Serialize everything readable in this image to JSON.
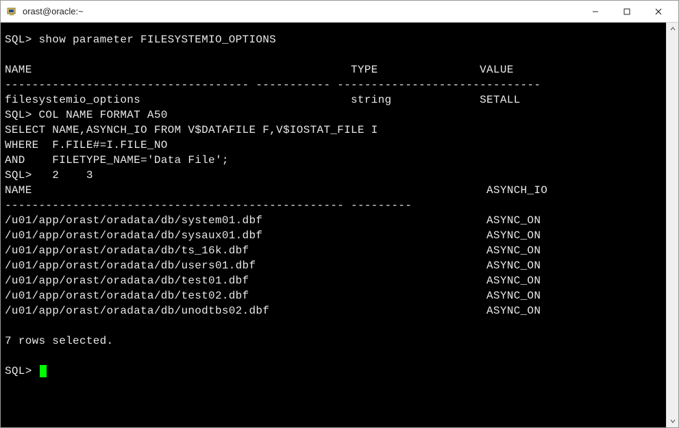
{
  "window": {
    "title": "orast@oracle:~"
  },
  "terminal": {
    "prompt": "SQL>",
    "lines": {
      "l0": "",
      "cmd1": "SQL> show parameter FILESYSTEMIO_OPTIONS",
      "blank1": "",
      "hdr1": "NAME                                               TYPE               VALUE",
      "sep1": "------------------------------------ ----------- ------------------------------",
      "row1": "filesystemio_options                               string             SETALL",
      "cmd2": "SQL> COL NAME FORMAT A50",
      "q1": "SELECT NAME,ASYNCH_IO FROM V$DATAFILE F,V$IOSTAT_FILE I",
      "q2": "WHERE  F.FILE#=I.FILE_NO",
      "q3": "AND    FILETYPE_NAME='Data File';",
      "q4": "SQL>   2    3",
      "hdr2": "NAME                                                                   ASYNCH_IO",
      "sep2": "-------------------------------------------------- ---------",
      "d1": "/u01/app/orast/oradata/db/system01.dbf                                 ASYNC_ON",
      "d2": "/u01/app/orast/oradata/db/sysaux01.dbf                                 ASYNC_ON",
      "d3": "/u01/app/orast/oradata/db/ts_16k.dbf                                   ASYNC_ON",
      "d4": "/u01/app/orast/oradata/db/users01.dbf                                  ASYNC_ON",
      "d5": "/u01/app/orast/oradata/db/test01.dbf                                   ASYNC_ON",
      "d6": "/u01/app/orast/oradata/db/test02.dbf                                   ASYNC_ON",
      "d7": "/u01/app/orast/oradata/db/unodtbs02.dbf                                ASYNC_ON",
      "blank2": "",
      "summary": "7 rows selected.",
      "blank3": "",
      "prompt2": "SQL> "
    }
  }
}
